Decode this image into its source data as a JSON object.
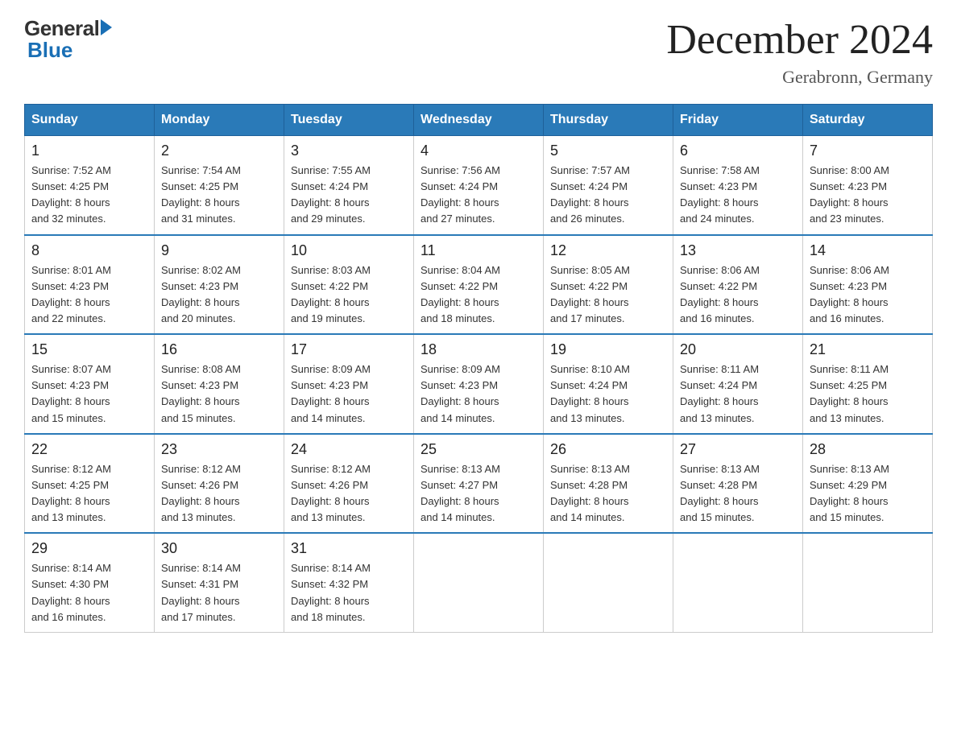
{
  "header": {
    "logo_general": "General",
    "logo_blue": "Blue",
    "title": "December 2024",
    "subtitle": "Gerabronn, Germany"
  },
  "weekdays": [
    "Sunday",
    "Monday",
    "Tuesday",
    "Wednesday",
    "Thursday",
    "Friday",
    "Saturday"
  ],
  "weeks": [
    [
      {
        "day": "1",
        "info": "Sunrise: 7:52 AM\nSunset: 4:25 PM\nDaylight: 8 hours\nand 32 minutes."
      },
      {
        "day": "2",
        "info": "Sunrise: 7:54 AM\nSunset: 4:25 PM\nDaylight: 8 hours\nand 31 minutes."
      },
      {
        "day": "3",
        "info": "Sunrise: 7:55 AM\nSunset: 4:24 PM\nDaylight: 8 hours\nand 29 minutes."
      },
      {
        "day": "4",
        "info": "Sunrise: 7:56 AM\nSunset: 4:24 PM\nDaylight: 8 hours\nand 27 minutes."
      },
      {
        "day": "5",
        "info": "Sunrise: 7:57 AM\nSunset: 4:24 PM\nDaylight: 8 hours\nand 26 minutes."
      },
      {
        "day": "6",
        "info": "Sunrise: 7:58 AM\nSunset: 4:23 PM\nDaylight: 8 hours\nand 24 minutes."
      },
      {
        "day": "7",
        "info": "Sunrise: 8:00 AM\nSunset: 4:23 PM\nDaylight: 8 hours\nand 23 minutes."
      }
    ],
    [
      {
        "day": "8",
        "info": "Sunrise: 8:01 AM\nSunset: 4:23 PM\nDaylight: 8 hours\nand 22 minutes."
      },
      {
        "day": "9",
        "info": "Sunrise: 8:02 AM\nSunset: 4:23 PM\nDaylight: 8 hours\nand 20 minutes."
      },
      {
        "day": "10",
        "info": "Sunrise: 8:03 AM\nSunset: 4:22 PM\nDaylight: 8 hours\nand 19 minutes."
      },
      {
        "day": "11",
        "info": "Sunrise: 8:04 AM\nSunset: 4:22 PM\nDaylight: 8 hours\nand 18 minutes."
      },
      {
        "day": "12",
        "info": "Sunrise: 8:05 AM\nSunset: 4:22 PM\nDaylight: 8 hours\nand 17 minutes."
      },
      {
        "day": "13",
        "info": "Sunrise: 8:06 AM\nSunset: 4:22 PM\nDaylight: 8 hours\nand 16 minutes."
      },
      {
        "day": "14",
        "info": "Sunrise: 8:06 AM\nSunset: 4:23 PM\nDaylight: 8 hours\nand 16 minutes."
      }
    ],
    [
      {
        "day": "15",
        "info": "Sunrise: 8:07 AM\nSunset: 4:23 PM\nDaylight: 8 hours\nand 15 minutes."
      },
      {
        "day": "16",
        "info": "Sunrise: 8:08 AM\nSunset: 4:23 PM\nDaylight: 8 hours\nand 15 minutes."
      },
      {
        "day": "17",
        "info": "Sunrise: 8:09 AM\nSunset: 4:23 PM\nDaylight: 8 hours\nand 14 minutes."
      },
      {
        "day": "18",
        "info": "Sunrise: 8:09 AM\nSunset: 4:23 PM\nDaylight: 8 hours\nand 14 minutes."
      },
      {
        "day": "19",
        "info": "Sunrise: 8:10 AM\nSunset: 4:24 PM\nDaylight: 8 hours\nand 13 minutes."
      },
      {
        "day": "20",
        "info": "Sunrise: 8:11 AM\nSunset: 4:24 PM\nDaylight: 8 hours\nand 13 minutes."
      },
      {
        "day": "21",
        "info": "Sunrise: 8:11 AM\nSunset: 4:25 PM\nDaylight: 8 hours\nand 13 minutes."
      }
    ],
    [
      {
        "day": "22",
        "info": "Sunrise: 8:12 AM\nSunset: 4:25 PM\nDaylight: 8 hours\nand 13 minutes."
      },
      {
        "day": "23",
        "info": "Sunrise: 8:12 AM\nSunset: 4:26 PM\nDaylight: 8 hours\nand 13 minutes."
      },
      {
        "day": "24",
        "info": "Sunrise: 8:12 AM\nSunset: 4:26 PM\nDaylight: 8 hours\nand 13 minutes."
      },
      {
        "day": "25",
        "info": "Sunrise: 8:13 AM\nSunset: 4:27 PM\nDaylight: 8 hours\nand 14 minutes."
      },
      {
        "day": "26",
        "info": "Sunrise: 8:13 AM\nSunset: 4:28 PM\nDaylight: 8 hours\nand 14 minutes."
      },
      {
        "day": "27",
        "info": "Sunrise: 8:13 AM\nSunset: 4:28 PM\nDaylight: 8 hours\nand 15 minutes."
      },
      {
        "day": "28",
        "info": "Sunrise: 8:13 AM\nSunset: 4:29 PM\nDaylight: 8 hours\nand 15 minutes."
      }
    ],
    [
      {
        "day": "29",
        "info": "Sunrise: 8:14 AM\nSunset: 4:30 PM\nDaylight: 8 hours\nand 16 minutes."
      },
      {
        "day": "30",
        "info": "Sunrise: 8:14 AM\nSunset: 4:31 PM\nDaylight: 8 hours\nand 17 minutes."
      },
      {
        "day": "31",
        "info": "Sunrise: 8:14 AM\nSunset: 4:32 PM\nDaylight: 8 hours\nand 18 minutes."
      },
      {
        "day": "",
        "info": ""
      },
      {
        "day": "",
        "info": ""
      },
      {
        "day": "",
        "info": ""
      },
      {
        "day": "",
        "info": ""
      }
    ]
  ]
}
